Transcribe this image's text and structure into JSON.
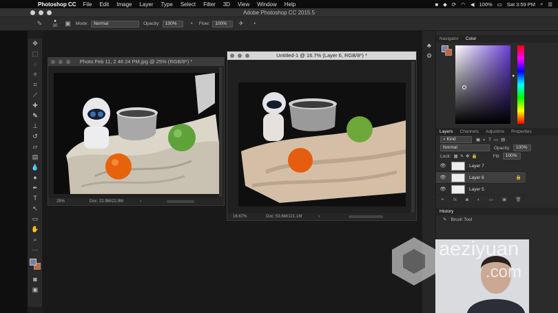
{
  "menubar": {
    "app_name": "Photoshop CC",
    "items": [
      "File",
      "Edit",
      "Image",
      "Layer",
      "Type",
      "Select",
      "Filter",
      "3D",
      "View",
      "Window",
      "Help"
    ],
    "battery": "100%",
    "clock": "Sat 3:59 PM"
  },
  "window": {
    "title": "Adobe Photoshop CC 2015.5"
  },
  "options": {
    "brush_size": "30",
    "mode_label": "Mode:",
    "mode_value": "Normal",
    "opacity_label": "Opacity:",
    "opacity_value": "100%",
    "flow_label": "Flow:",
    "flow_value": "100%"
  },
  "doc_photo": {
    "title": "Photo Feb 11, 2 46 24 PM.jpg @ 25% (RGB/8*) *",
    "zoom": "25%",
    "doc_size": "Doc: 22.9M/22.9M"
  },
  "doc_untitled": {
    "title": "Untitled-1 @ 16.7% (Layer 6, RGB/8*) *",
    "zoom": "16.67%",
    "doc_size": "Doc: 53.6M/121.1M"
  },
  "panels": {
    "navigator_tab": "Navigator",
    "color_tab": "Color",
    "layers_tabs": [
      "Layers",
      "Channels",
      "Adjustme",
      "Properties"
    ],
    "kind_label": "Kind",
    "blend_mode": "Normal",
    "opacity_label": "Opacity:",
    "opacity_value": "100%",
    "lock_label": "Lock:",
    "fill_label": "Fill:",
    "fill_value": "100%",
    "layers": [
      {
        "name": "Layer 7"
      },
      {
        "name": "Layer 6"
      },
      {
        "name": "Layer 5"
      }
    ],
    "history_tab": "History",
    "history_item": "Brush Tool"
  },
  "watermark": {
    "line1": "aeziyuan",
    "line2": ".com"
  },
  "colors": {
    "accent": "#6a3fd6",
    "fg_swatch": "#7a7fa0",
    "bg_swatch": "#c8643c"
  }
}
